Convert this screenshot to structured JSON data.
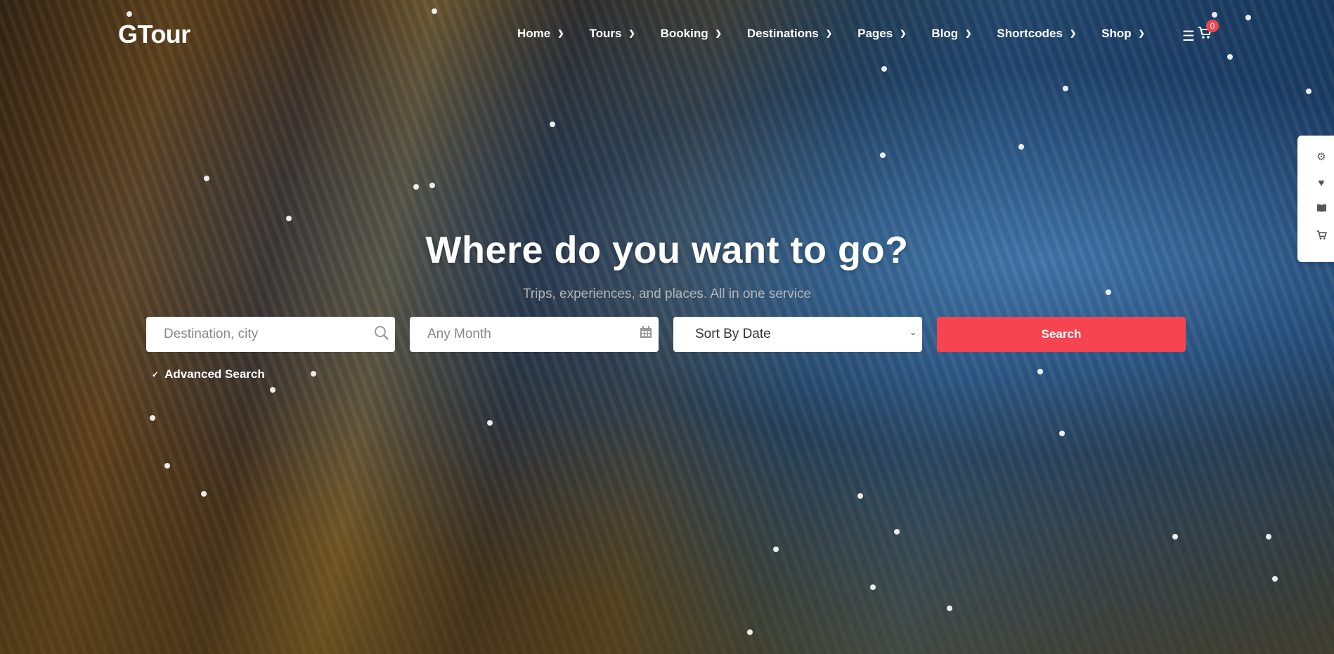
{
  "header": {
    "logo": "GTour",
    "nav": [
      {
        "label": "Home"
      },
      {
        "label": "Tours"
      },
      {
        "label": "Booking"
      },
      {
        "label": "Destinations"
      },
      {
        "label": "Pages"
      },
      {
        "label": "Blog"
      },
      {
        "label": "Shortcodes"
      },
      {
        "label": "Shop"
      }
    ],
    "cart_count": "0"
  },
  "hero": {
    "title": "Where do you want to go?",
    "subtitle": "Trips, experiences, and places. All in one service"
  },
  "search": {
    "destination_placeholder": "Destination, city",
    "month_placeholder": "Any Month",
    "sort_value": "Sort By Date",
    "button_label": "Search",
    "advanced_label": "Advanced Search"
  },
  "colors": {
    "accent": "#f64550",
    "badge": "#f2434f"
  },
  "icons": {
    "search_field": "search-icon",
    "month_field": "calendar-icon",
    "side_panel": [
      "gear-icon",
      "heart-icon",
      "book-icon",
      "cart-icon"
    ]
  }
}
